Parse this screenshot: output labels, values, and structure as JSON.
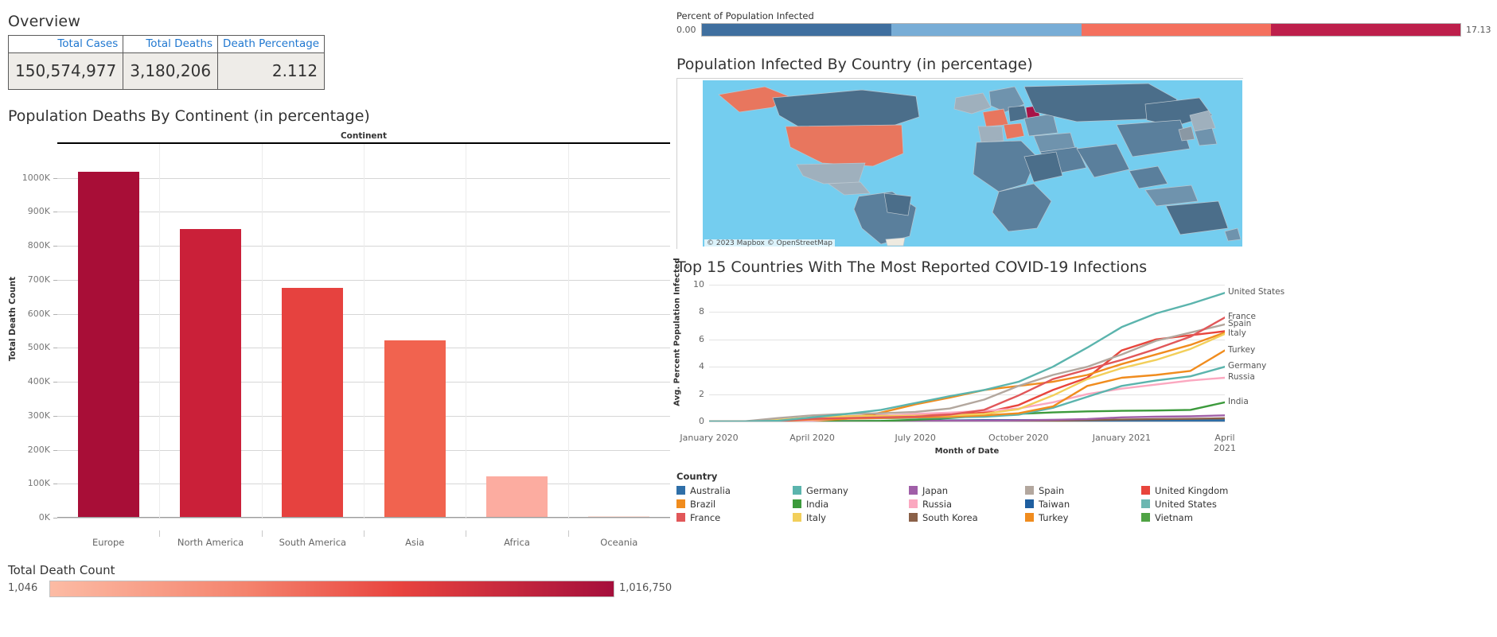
{
  "overview": {
    "title": "Overview",
    "columns": [
      "Total Cases",
      "Total Deaths",
      "Death Percentage"
    ],
    "values": [
      "150,574,977",
      "3,180,206",
      "2.112"
    ]
  },
  "bar_panel": {
    "title": "Population Deaths By Continent (in percentage)",
    "legend_title": "Total Death Count",
    "legend_min": "1,046",
    "legend_max": "1,016,750",
    "legend_color_min": "#fcbba4",
    "legend_color_max": "#a50f3c"
  },
  "map_panel": {
    "percent_legend_title": "Percent of  Population Infected",
    "percent_min": "0.00",
    "percent_max": "17.13",
    "percent_bins": [
      "#3f6f9f",
      "#78add6",
      "#f4705e",
      "#bd1f4b"
    ],
    "title": "Population Infected By Country (in percentage)",
    "attribution": "© 2023 Mapbox © OpenStreetMap",
    "ocean_color": "#74cdef"
  },
  "line_panel": {
    "title": "Top 15 Countries With The Most Reported COVID-19 Infections",
    "legend_title": "Country"
  },
  "chart_data": [
    {
      "type": "bar",
      "title": "Population Deaths By Continent (in percentage)",
      "xlabel": "Continent",
      "ylabel": "Total Death Count",
      "categories": [
        "Europe",
        "North America",
        "South America",
        "Asia",
        "Africa",
        "Oceania"
      ],
      "values": [
        1016750,
        848000,
        673000,
        519000,
        119000,
        1046
      ],
      "colors": [
        "#a80e37",
        "#ca2039",
        "#e6423f",
        "#f1634f",
        "#fcaca0",
        "#fde0d8"
      ],
      "ylim": [
        0,
        1100000
      ],
      "yticks": [
        0,
        100000,
        200000,
        300000,
        400000,
        500000,
        600000,
        700000,
        800000,
        900000,
        1000000
      ],
      "ytick_labels": [
        "0K",
        "100K",
        "200K",
        "300K",
        "400K",
        "500K",
        "600K",
        "700K",
        "800K",
        "900K",
        "1000K"
      ],
      "grid": true,
      "legend": "none"
    },
    {
      "type": "line",
      "title": "Top 15 Countries With The Most Reported COVID-19 Infections",
      "xlabel": "Month of Date",
      "ylabel": "Avg. Percent Population Infected",
      "ylim": [
        0,
        10
      ],
      "yticks": [
        0,
        2,
        4,
        6,
        8,
        10
      ],
      "ytick_labels": [
        "0",
        "2",
        "4",
        "6",
        "8",
        "10"
      ],
      "xticks": [
        "January 2020",
        "April 2020",
        "July 2020",
        "October 2020",
        "January 2021",
        "April 2021"
      ],
      "grid": true,
      "legend": "bottom",
      "x": [
        "2020-01",
        "2020-02",
        "2020-03",
        "2020-04",
        "2020-05",
        "2020-06",
        "2020-07",
        "2020-08",
        "2020-09",
        "2020-10",
        "2020-11",
        "2020-12",
        "2021-01",
        "2021-02",
        "2021-03",
        "2021-04"
      ],
      "series": [
        {
          "name": "United States",
          "color": "#5bb4ad",
          "end_label": "United States",
          "values": [
            0,
            0,
            0.05,
            0.3,
            0.55,
            0.85,
            1.35,
            1.85,
            2.3,
            2.9,
            4.0,
            5.4,
            6.9,
            7.9,
            8.6,
            9.4
          ]
        },
        {
          "name": "France",
          "color": "#e15759",
          "end_label": "France",
          "values": [
            0,
            0,
            0.03,
            0.2,
            0.25,
            0.3,
            0.35,
            0.5,
            0.85,
            1.9,
            3.1,
            3.8,
            4.5,
            5.3,
            6.2,
            7.6
          ]
        },
        {
          "name": "Spain",
          "color": "#b3a79e",
          "end_label": "Spain",
          "values": [
            0,
            0,
            0.25,
            0.45,
            0.55,
            0.6,
            0.7,
            0.95,
            1.6,
            2.6,
            3.4,
            4.0,
            4.9,
            5.9,
            6.5,
            7.1
          ]
        },
        {
          "name": "Italy",
          "color": "#f2cf5b",
          "end_label": "Italy",
          "values": [
            0,
            0,
            0.12,
            0.3,
            0.38,
            0.4,
            0.42,
            0.45,
            0.55,
            0.9,
            1.9,
            3.1,
            3.9,
            4.5,
            5.3,
            6.4
          ]
        },
        {
          "name": "Turkey",
          "color": "#f08c1e",
          "end_label": "Turkey",
          "values": [
            0,
            0,
            0.02,
            0.15,
            0.2,
            0.25,
            0.3,
            0.35,
            0.45,
            0.6,
            1.1,
            2.6,
            3.2,
            3.4,
            3.7,
            5.2
          ]
        },
        {
          "name": "Germany",
          "color": "#5bb4ad",
          "end_label": "Germany",
          "values": [
            0,
            0,
            0.06,
            0.18,
            0.22,
            0.24,
            0.26,
            0.3,
            0.35,
            0.5,
            1.0,
            1.8,
            2.6,
            3.0,
            3.3,
            4.0
          ]
        },
        {
          "name": "Russia",
          "color": "#fba8c0",
          "end_label": "Russia",
          "values": [
            0,
            0,
            0.01,
            0.07,
            0.25,
            0.42,
            0.55,
            0.65,
            0.78,
            0.95,
            1.4,
            2.0,
            2.4,
            2.7,
            3.0,
            3.2
          ]
        },
        {
          "name": "Brazil",
          "color": "#f08c1e",
          "end_label": "",
          "values": [
            0,
            0,
            0.01,
            0.04,
            0.2,
            0.65,
            1.25,
            1.75,
            2.3,
            2.6,
            2.9,
            3.4,
            4.2,
            4.9,
            5.6,
            6.5
          ]
        },
        {
          "name": "United Kingdom",
          "color": "#e8453c",
          "end_label": "",
          "values": [
            0,
            0,
            0.04,
            0.25,
            0.38,
            0.44,
            0.48,
            0.52,
            0.65,
            1.2,
            2.3,
            3.2,
            5.2,
            6.0,
            6.3,
            6.6
          ]
        },
        {
          "name": "India",
          "color": "#3c9a3c",
          "end_label": "India",
          "values": [
            0,
            0,
            0.001,
            0.003,
            0.015,
            0.04,
            0.12,
            0.25,
            0.43,
            0.56,
            0.66,
            0.74,
            0.78,
            0.8,
            0.85,
            1.4
          ]
        },
        {
          "name": "Japan",
          "color": "#a05fa8",
          "end_label": "",
          "values": [
            0,
            0,
            0.001,
            0.01,
            0.013,
            0.015,
            0.03,
            0.05,
            0.06,
            0.08,
            0.12,
            0.18,
            0.3,
            0.35,
            0.38,
            0.45
          ]
        },
        {
          "name": "South Korea",
          "color": "#8a6048",
          "end_label": "",
          "values": [
            0,
            0.01,
            0.018,
            0.021,
            0.022,
            0.024,
            0.027,
            0.03,
            0.045,
            0.05,
            0.06,
            0.1,
            0.14,
            0.17,
            0.19,
            0.23
          ]
        },
        {
          "name": "Australia",
          "color": "#2f6fa8",
          "end_label": "",
          "values": [
            0,
            0,
            0.01,
            0.025,
            0.028,
            0.03,
            0.05,
            0.08,
            0.105,
            0.107,
            0.108,
            0.11,
            0.112,
            0.114,
            0.115,
            0.117
          ]
        },
        {
          "name": "Taiwan",
          "color": "#2f6fa8",
          "end_label": "",
          "values": [
            0,
            0.0004,
            0.001,
            0.0018,
            0.0019,
            0.002,
            0.002,
            0.0021,
            0.0022,
            0.0023,
            0.0025,
            0.0033,
            0.0037,
            0.0039,
            0.004,
            0.0043
          ]
        },
        {
          "name": "Vietnam",
          "color": "#4fa344",
          "end_label": "",
          "values": [
            0,
            0.0001,
            0.0002,
            0.0003,
            0.0003,
            0.0004,
            0.0004,
            0.001,
            0.0011,
            0.0012,
            0.0013,
            0.0015,
            0.0017,
            0.0025,
            0.0026,
            0.003
          ]
        }
      ]
    }
  ],
  "country_legend": [
    {
      "label": "Australia",
      "color": "#2f6fa8"
    },
    {
      "label": "Brazil",
      "color": "#f08c1e"
    },
    {
      "label": "France",
      "color": "#e15759"
    },
    {
      "label": "Germany",
      "color": "#5bb4ad"
    },
    {
      "label": "India",
      "color": "#3c9a3c"
    },
    {
      "label": "Italy",
      "color": "#f2cf5b"
    },
    {
      "label": "Japan",
      "color": "#a05fa8"
    },
    {
      "label": "Russia",
      "color": "#fba8c0"
    },
    {
      "label": "South Korea",
      "color": "#8a6048"
    },
    {
      "label": "Spain",
      "color": "#b3a79e"
    },
    {
      "label": "Taiwan",
      "color": "#1f5fa0"
    },
    {
      "label": "Turkey",
      "color": "#f08c1e"
    },
    {
      "label": "United Kingdom",
      "color": "#e8453c"
    },
    {
      "label": "United States",
      "color": "#6cb7b1"
    },
    {
      "label": "Vietnam",
      "color": "#4fa344"
    }
  ]
}
